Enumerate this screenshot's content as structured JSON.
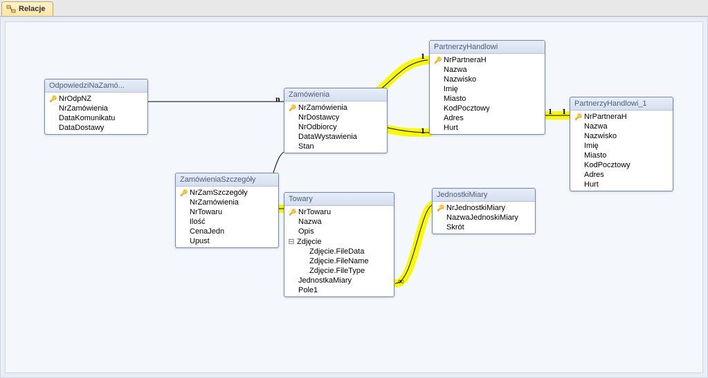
{
  "tab": {
    "label": "Relacje"
  },
  "tables": {
    "odp": {
      "title": "OdpowiedziNaZamó...",
      "fields": [
        {
          "name": "NrOdpNZ",
          "pk": true
        },
        {
          "name": "NrZamówienia"
        },
        {
          "name": "DataKomunikatu"
        },
        {
          "name": "DataDostawy"
        }
      ]
    },
    "zam": {
      "title": "Zamówienia",
      "fields": [
        {
          "name": "NrZamówienia",
          "pk": true
        },
        {
          "name": "NrDostawcy"
        },
        {
          "name": "NrOdbiorcy"
        },
        {
          "name": "DataWystawienia"
        },
        {
          "name": "Stan"
        }
      ]
    },
    "zamSz": {
      "title": "ZamówieniaSzczegóły",
      "fields": [
        {
          "name": "NrZamSzczegóły",
          "pk": true
        },
        {
          "name": "NrZamówienia"
        },
        {
          "name": "NrTowaru"
        },
        {
          "name": "Ilość"
        },
        {
          "name": "CenaJedn"
        },
        {
          "name": "Upust"
        }
      ]
    },
    "towary": {
      "title": "Towary",
      "fields": [
        {
          "name": "NrTowaru",
          "pk": true
        },
        {
          "name": "Nazwa"
        },
        {
          "name": "Opis"
        },
        {
          "name": "Zdjęcie",
          "expandable": true,
          "sub": [
            "Zdjęcie.FileData",
            "Zdjęcie.FileName",
            "Zdjęcie.FileType"
          ]
        },
        {
          "name": "JednostkaMiary"
        },
        {
          "name": "Pole1"
        }
      ]
    },
    "partnerzy": {
      "title": "PartnerzyHandlowi",
      "fields": [
        {
          "name": "NrPartneraH",
          "pk": true
        },
        {
          "name": "Nazwa"
        },
        {
          "name": "Nazwisko"
        },
        {
          "name": "Imię"
        },
        {
          "name": "Miasto"
        },
        {
          "name": "KodPocztowy"
        },
        {
          "name": "Adres"
        },
        {
          "name": "Hurt"
        }
      ]
    },
    "partnerzy1": {
      "title": "PartnerzyHandlowi_1",
      "fields": [
        {
          "name": "NrPartneraH",
          "pk": true
        },
        {
          "name": "Nazwa"
        },
        {
          "name": "Nazwisko"
        },
        {
          "name": "Imię"
        },
        {
          "name": "Miasto"
        },
        {
          "name": "KodPocztowy"
        },
        {
          "name": "Adres"
        },
        {
          "name": "Hurt"
        }
      ]
    },
    "jm": {
      "title": "JednostkiMiary",
      "fields": [
        {
          "name": "NrJednostkiMiary",
          "pk": true
        },
        {
          "name": "NazwaJednoskiMiary"
        },
        {
          "name": "Skrót"
        }
      ]
    }
  },
  "symbols": {
    "infinity": "∞",
    "n": "n",
    "one": "1",
    "minus": "⊟"
  }
}
